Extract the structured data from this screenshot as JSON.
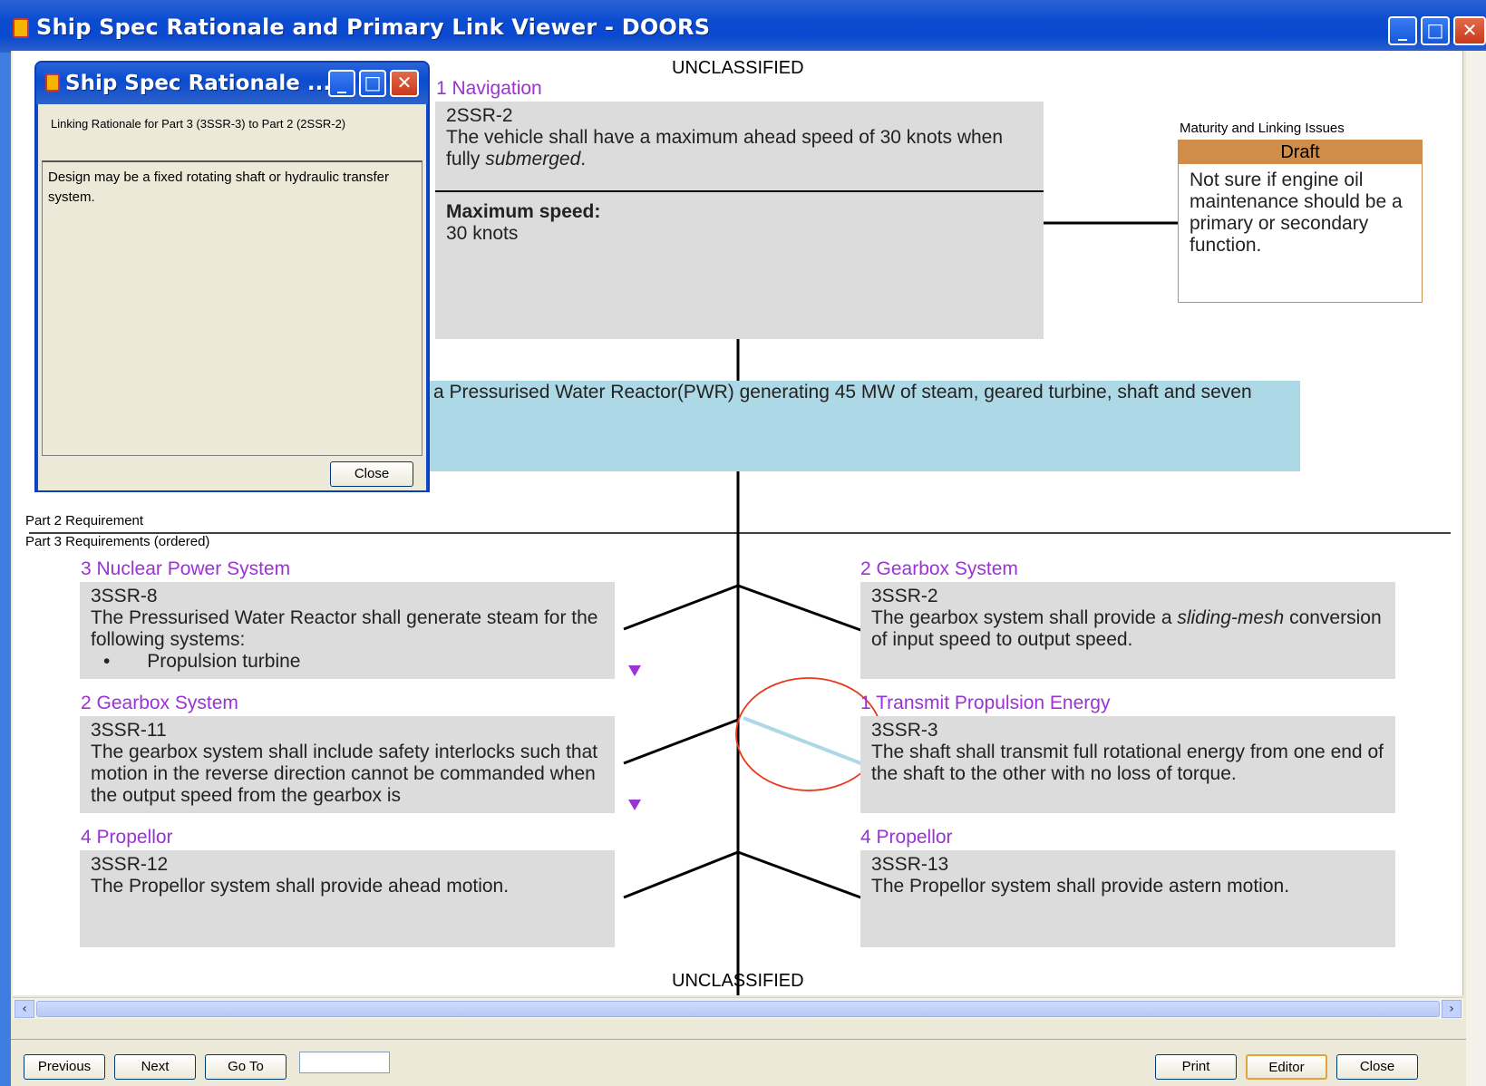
{
  "window": {
    "title": "Ship Spec Rationale and Primary Link Viewer - DOORS",
    "min": "_",
    "max": "□",
    "close": "✕"
  },
  "classification": {
    "top": "UNCLASSIFIED",
    "bottom": "UNCLASSIFIED"
  },
  "part1": {
    "heading": "1 Navigation",
    "id": "2SSR-2",
    "text_pre": "The vehicle shall have a maximum ahead speed of 30 knots when fully",
    "text_em": "submerged",
    "text_post": ".",
    "attr_label": "Maximum speed:",
    "attr_value": "30 knots"
  },
  "issues": {
    "title": "Maturity and Linking Issues",
    "status": "Draft",
    "text": "Not sure if engine oil maintenance should be a primary or secondary function."
  },
  "pwr_text": "a Pressurised Water Reactor(PWR) generating 45 MW of steam, geared turbine, shaft and seven",
  "part2_label": "Part 2 Requirement",
  "part3_label": "Part 3 Requirements (ordered)",
  "left_reqs": [
    {
      "heading": "3 Nuclear Power System",
      "id": "3SSR-8",
      "text": "The Pressurised Water Reactor shall generate steam for the following systems:",
      "bullet": "Propulsion turbine"
    },
    {
      "heading": "2 Gearbox System",
      "id": "3SSR-11",
      "text": "The gearbox system shall include safety interlocks such that motion in the reverse direction cannot be commanded when the output speed from the gearbox is"
    },
    {
      "heading": "4 Propellor",
      "id": "3SSR-12",
      "text": "The Propellor system shall provide ahead motion."
    }
  ],
  "right_reqs": [
    {
      "heading": "2 Gearbox System",
      "id": "3SSR-2",
      "text_pre": "The gearbox system shall provide a ",
      "text_em": "sliding-mesh",
      "text_post": " conversion of input speed to output speed."
    },
    {
      "heading": "1 Transmit Propulsion Energy",
      "id": "3SSR-3",
      "text": "The shaft shall transmit full rotational energy from one end of the shaft to the other with no loss of torque."
    },
    {
      "heading": "4 Propellor",
      "id": "3SSR-13",
      "text": "The Propellor system shall provide astern motion."
    }
  ],
  "dialog": {
    "title": "Ship Spec Rationale ...",
    "label": "Linking Rationale for Part 3 (3SSR-3) to Part 2 (2SSR-2)",
    "text": "Design  may be a fixed rotating shaft or hydraulic transfer system.",
    "close": "Close"
  },
  "buttons": {
    "previous": "Previous",
    "next": "Next",
    "goto": "Go To",
    "print": "Print",
    "editor": "Editor",
    "close": "Close"
  },
  "colors": {
    "accent": "#9b32d6",
    "issues": "#d08d4a",
    "pwr_bg": "#add8e6",
    "highlight": "#e8391a"
  }
}
